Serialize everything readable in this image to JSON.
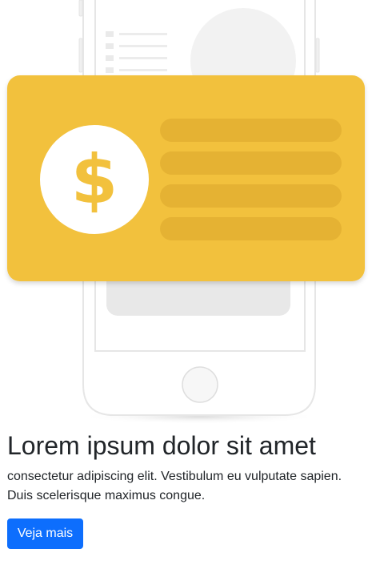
{
  "illustration": {
    "card_color": "#F2C13D",
    "bar_color": "#E5B233",
    "coin_symbol": "$",
    "coin_icon": "dollar-coin-icon",
    "phone_icon": "smartphone-outline-illustration"
  },
  "content": {
    "title": "Lorem ipsum dolor sit amet",
    "description": "consectetur adipiscing elit. Vestibulum eu vulputate sapien. Duis scelerisque maximus congue.",
    "cta_label": "Veja mais",
    "cta_color": "#0D6EFD"
  }
}
